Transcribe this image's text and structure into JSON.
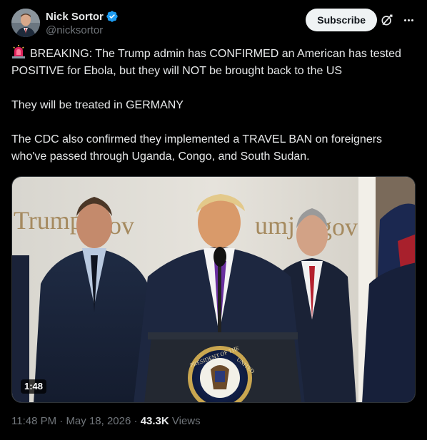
{
  "author": {
    "display_name": "Nick Sortor",
    "handle": "@nicksortor",
    "verified": true,
    "verified_color": "#1d9bf0"
  },
  "actions": {
    "subscribe_label": "Subscribe",
    "grok_icon": "grok-icon",
    "more_icon": "more-icon"
  },
  "post": {
    "emoji": "siren-icon",
    "paragraphs": [
      "BREAKING: The Trump admin has CONFIRMED an American has tested POSITIVE for Ebola, but they will NOT be brought back to the US",
      "They will be treated in GERMANY",
      "The CDC also confirmed they implemented a TRAVEL BAN on foreigners who've passed through Uganda, Congo, and South Sudan."
    ]
  },
  "media": {
    "type": "video",
    "duration": "1:48",
    "backdrop_text_left": "TrumpR",
    "backdrop_text_left2": "ov",
    "backdrop_text_right": "umj",
    "backdrop_text_right2": "gov",
    "seal_text_top": "PRESIDENT OF THE",
    "seal_text_right": "UNITED"
  },
  "meta": {
    "time": "11:48 PM",
    "separator": "·",
    "date": "May 18, 2026",
    "views_count": "43.3K",
    "views_label": "Views"
  },
  "colors": {
    "background": "#000000",
    "text": "#e7e9ea",
    "secondary": "#71767b",
    "accent": "#1d9bf0"
  }
}
